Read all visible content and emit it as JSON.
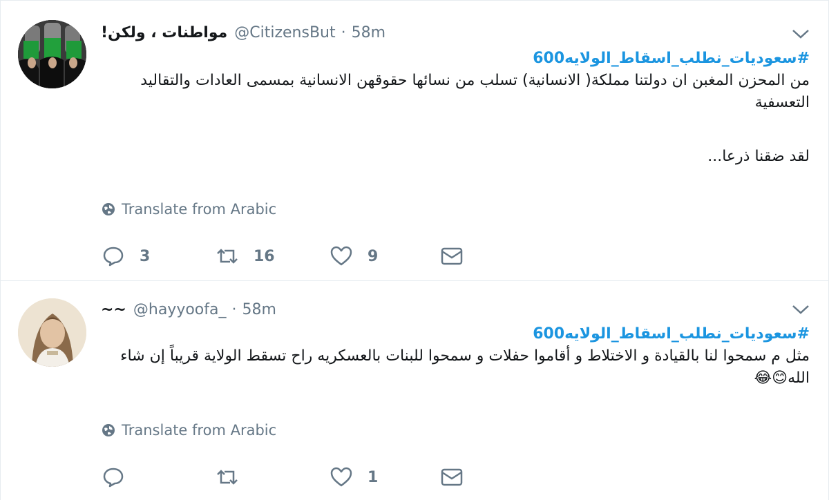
{
  "tweets": [
    {
      "display_name": "مواطنات ، ولكن!",
      "handle": "@CitizensBut",
      "separator": "·",
      "time": "58m",
      "hashtag": "#سعوديات_نطلب_اسقاط_الولايه600",
      "body_line1": "من المحزن المغبن ان دولتنا مملكة( الانسانية) تسلب من نسائها حقوقهن الانسانية بمسمى العادات والتقاليد التعسفية",
      "body_line2": "لقد ضقنا ذرعا...",
      "translate_label": "Translate from Arabic",
      "reply_count": "3",
      "retweet_count": "16",
      "like_count": "9"
    },
    {
      "display_name": "~~",
      "handle": "@hayyoofa_",
      "separator": "·",
      "time": "58m",
      "hashtag": "#سعوديات_نطلب_اسقاط_الولايه600",
      "body_line1": "مثل م سمحوا لنا بالقيادة و الاختلاط و أقاموا حفلات و سمحوا للبنات بالعسكريه راح تسقط الولاية قريباً إن شاء الله😊😂",
      "translate_label": "Translate from Arabic",
      "reply_count": "",
      "retweet_count": "",
      "like_count": "1"
    }
  ],
  "icons": {
    "caret": "chevron-down-icon",
    "globe": "globe-icon",
    "reply": "reply-icon",
    "retweet": "retweet-icon",
    "like": "heart-icon",
    "dm": "envelope-icon"
  },
  "colors": {
    "link": "#1b95e0",
    "muted": "#657786",
    "text": "#14171a",
    "border": "#e6ecf0"
  }
}
